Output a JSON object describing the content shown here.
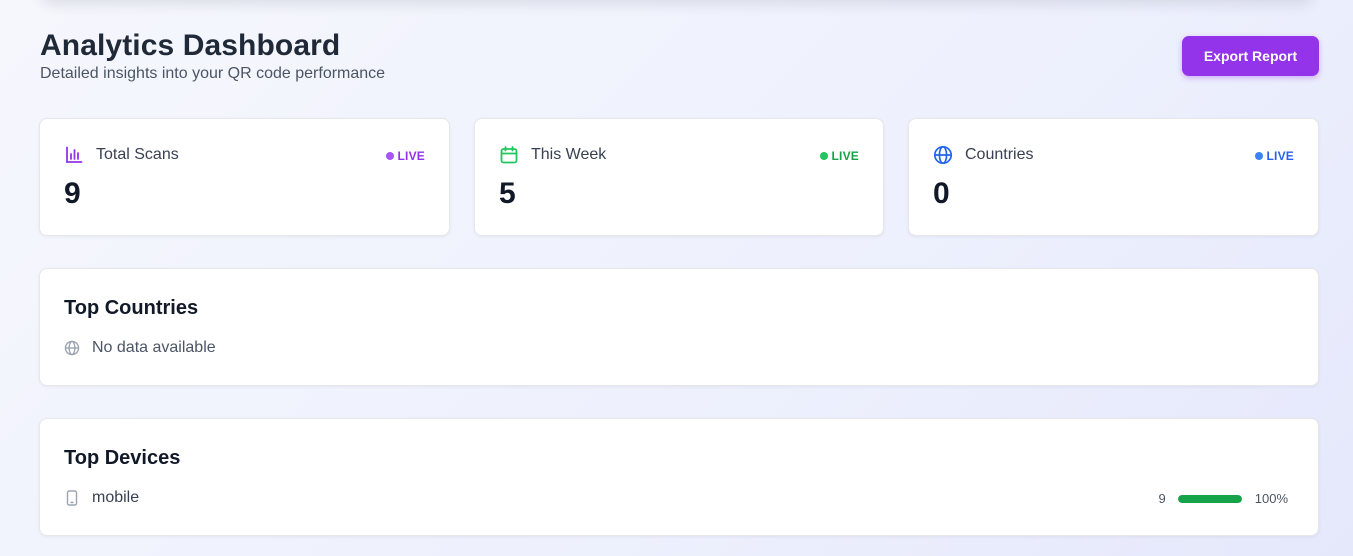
{
  "header": {
    "title": "Analytics Dashboard",
    "subtitle": "Detailed insights into your QR code performance",
    "export_label": "Export Report"
  },
  "stats": [
    {
      "label": "Total Scans",
      "value": "9",
      "live": "LIVE",
      "icon": "bar-chart-icon",
      "color": "#9333ea"
    },
    {
      "label": "This Week",
      "value": "5",
      "live": "LIVE",
      "icon": "calendar-icon",
      "color": "#22c55e"
    },
    {
      "label": "Countries",
      "value": "0",
      "live": "LIVE",
      "icon": "globe-icon",
      "color": "#3b82f6"
    }
  ],
  "top_countries": {
    "title": "Top Countries",
    "empty_text": "No data available",
    "icon": "globe-icon"
  },
  "top_devices": {
    "title": "Top Devices",
    "items": [
      {
        "name": "mobile",
        "count": "9",
        "percent_label": "100%",
        "share": 1.0,
        "icon": "smartphone-icon",
        "color": "#16a34a"
      }
    ]
  }
}
